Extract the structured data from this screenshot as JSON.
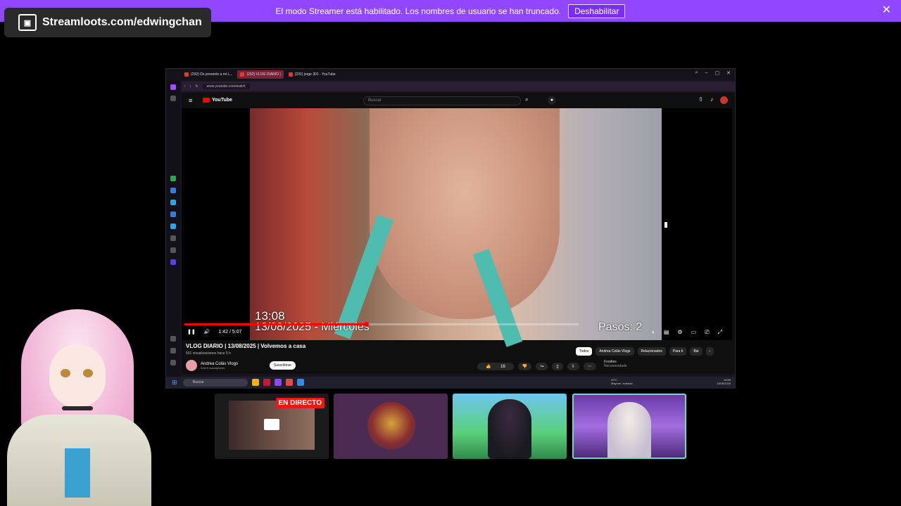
{
  "banner": {
    "text": "El modo Streamer está habilitado. Los nombres de usuario se han truncado.",
    "button": "Deshabilitar",
    "close_icon": "close-icon"
  },
  "streamloots": {
    "text": "Streamloots.com/edwingchan",
    "icon": "streamloots-card-icon"
  },
  "browser": {
    "tabs": [
      "(292) Os presento a mi L...",
      "(292) VLOG DIARIO |",
      "(291) jorge 301 - YouTube"
    ],
    "url": "www.youtube.com/watch"
  },
  "youtube": {
    "logo": "YouTube",
    "search_placeholder": "Buscar",
    "overlay_time": "13:08",
    "overlay_date": "13/08/2025 - Miércoles",
    "overlay_steps": "Pasos: 2",
    "progress": 0.46,
    "time_display": "1:42 / 5:07",
    "video_title": "VLOG DIARIO | 13/08/2025 | Volvemos a casa",
    "views": "501 visualizaciones  hace 5 h",
    "channel_name": "Andrea Colás Vlogs",
    "subscribers": "3,64 K suscriptores",
    "subscribe": "Suscribirse",
    "likes": "16",
    "chips": [
      "Todos",
      "Andrea Colás Vlogs",
      "Relacionados",
      "Para ti",
      "Bai"
    ],
    "side_item": "Foodies",
    "side_item_sub": "Recomendado"
  },
  "taskbar": {
    "search": "Buscar",
    "weather_temp": "29°C",
    "weather_text": "Mayorm. soleado",
    "time": "16:55",
    "date": "13/08/2025"
  },
  "thumbnails": {
    "live_badge": "EN DIRECTO"
  }
}
